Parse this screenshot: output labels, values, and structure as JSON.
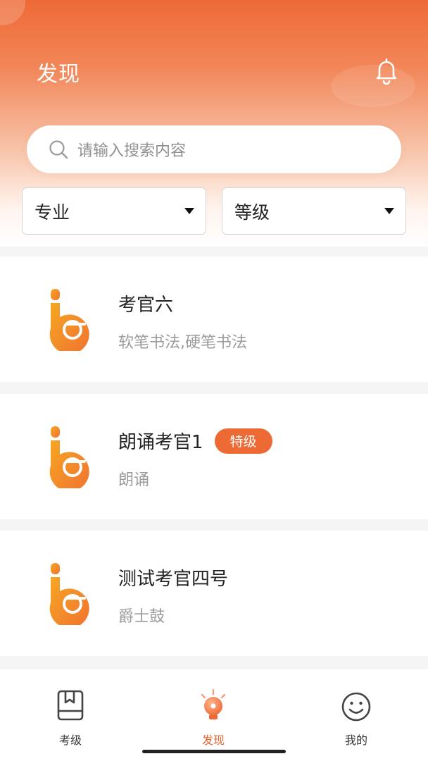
{
  "header": {
    "title": "发现",
    "bell_icon": "bell-icon"
  },
  "search": {
    "placeholder": "请输入搜索内容",
    "icon": "search-icon"
  },
  "filters": {
    "major_label": "专业",
    "level_label": "等级"
  },
  "examiners": [
    {
      "name": "考官六",
      "badge": "",
      "subjects": "软笔书法,硬笔书法"
    },
    {
      "name": "朗诵考官1",
      "badge": "特级",
      "subjects": "朗诵"
    },
    {
      "name": "测试考官四号",
      "badge": "",
      "subjects": "爵士鼓"
    }
  ],
  "tabbar": {
    "items": [
      {
        "label": "考级",
        "icon": "book-icon",
        "active": false
      },
      {
        "label": "发现",
        "icon": "bulb-icon",
        "active": true
      },
      {
        "label": "我的",
        "icon": "smiley-icon",
        "active": false
      }
    ]
  },
  "colors": {
    "accent": "#ed6a35",
    "hero_top": "#ee6a36",
    "logo_gradient_start": "#f6a623",
    "logo_gradient_end": "#f07330"
  }
}
